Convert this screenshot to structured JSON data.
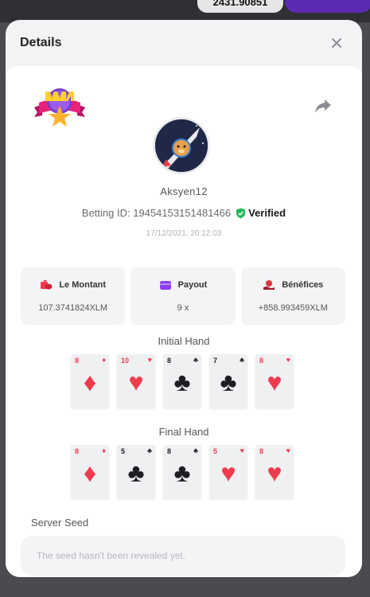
{
  "background": {
    "balance": "2431.90851"
  },
  "modal": {
    "title": "Details",
    "username": "Aksyen12",
    "betting_id_label": "Betting ID: 19454153151481466",
    "verified_label": "Verified",
    "date": "17/12/2021, 20:12:03",
    "stats": [
      {
        "label": "Le Montant",
        "value": "107.3741824XLM",
        "icon": "coins-icon",
        "color": "#ef3b4e"
      },
      {
        "label": "Payout",
        "value": "9 x",
        "icon": "wallet-icon",
        "color": "#8b3cf0"
      },
      {
        "label": "Bénéfices",
        "value": "+858.993459XLM",
        "icon": "money-hand-icon",
        "color": "#e0343c"
      }
    ],
    "initial_hand_title": "Initial Hand",
    "initial_hand": [
      {
        "rank": "8",
        "suit": "♦",
        "color": "red"
      },
      {
        "rank": "10",
        "suit": "♥",
        "color": "red"
      },
      {
        "rank": "8",
        "suit": "♣",
        "color": "black"
      },
      {
        "rank": "7",
        "suit": "♣",
        "color": "black"
      },
      {
        "rank": "8",
        "suit": "♥",
        "color": "red"
      }
    ],
    "final_hand_title": "Final Hand",
    "final_hand": [
      {
        "rank": "8",
        "suit": "♦",
        "color": "red"
      },
      {
        "rank": "5",
        "suit": "♣",
        "color": "black"
      },
      {
        "rank": "8",
        "suit": "♣",
        "color": "black"
      },
      {
        "rank": "5",
        "suit": "♥",
        "color": "red"
      },
      {
        "rank": "8",
        "suit": "♥",
        "color": "red"
      }
    ],
    "server_seed_label": "Server Seed",
    "server_seed_placeholder": "The seed hasn't been revealed yet."
  }
}
